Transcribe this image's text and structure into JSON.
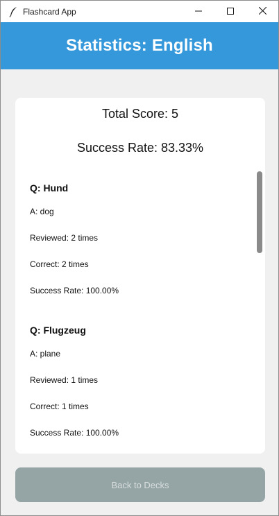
{
  "window": {
    "title": "Flashcard App",
    "icon": "feather-icon",
    "controls": [
      "minimize-icon",
      "maximize-icon",
      "close-icon"
    ]
  },
  "header": {
    "title": "Statistics: English",
    "color": "#3498db"
  },
  "summary": {
    "total_score": "Total Score: 5",
    "success_rate": "Success Rate: 83.33%"
  },
  "cards": [
    {
      "question": "Q: Hund",
      "answer": "A: dog",
      "reviewed": "Reviewed: 2 times",
      "correct": "Correct: 2 times",
      "success_rate": "Success Rate: 100.00%"
    },
    {
      "question": "Q: Flugzeug",
      "answer": "A: plane",
      "reviewed": "Reviewed: 1 times",
      "correct": "Correct: 1 times",
      "success_rate": "Success Rate: 100.00%"
    }
  ],
  "footer": {
    "back_label": "Back to Decks",
    "button_color": "#95a5a6"
  }
}
